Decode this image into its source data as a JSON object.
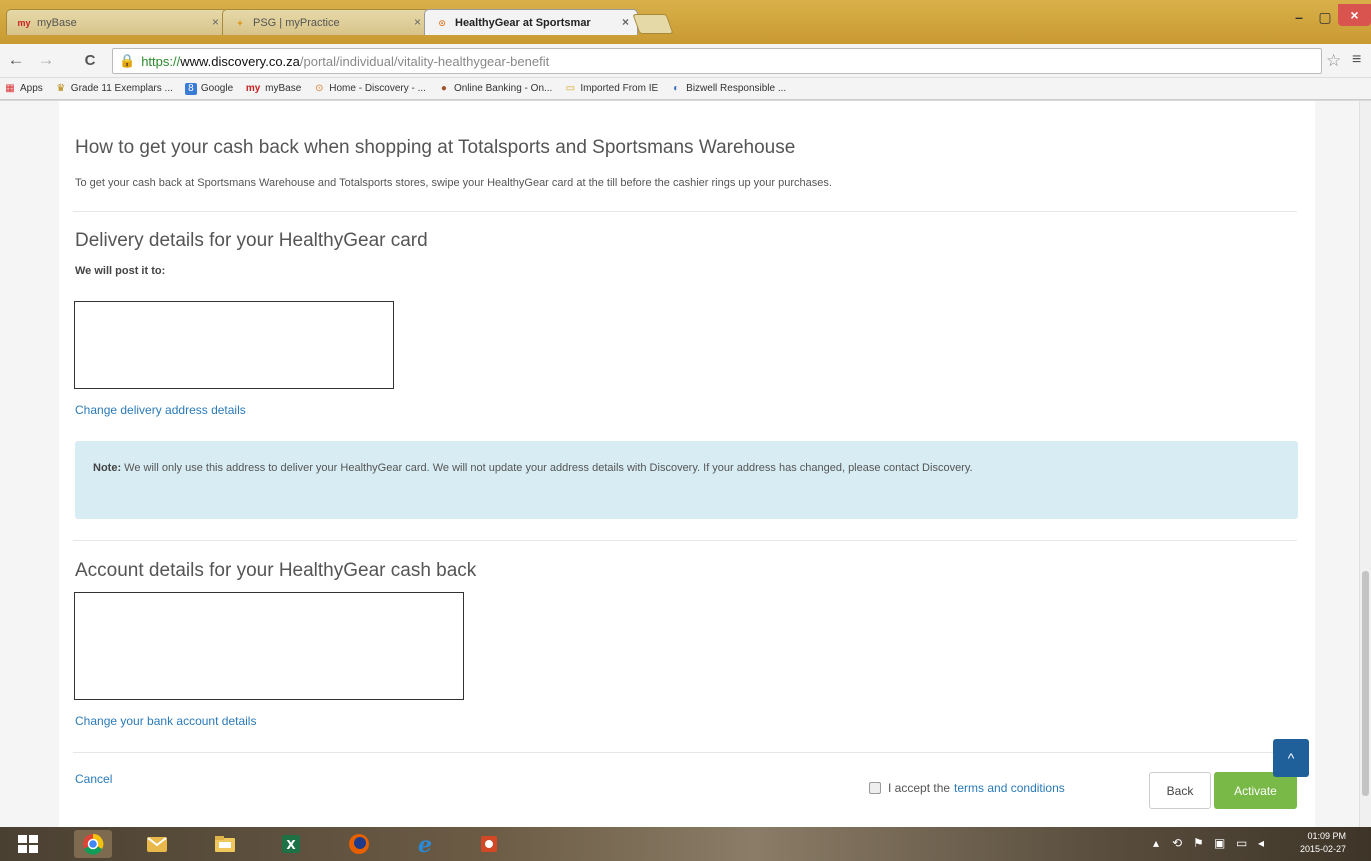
{
  "tabs": [
    {
      "label": "myBase",
      "favicon": "my",
      "close": "×"
    },
    {
      "label": "PSG | myPractice",
      "favicon": "+",
      "close": "×"
    },
    {
      "label": "HealthyGear at Sportsmar",
      "favicon": "⊙",
      "close": "×"
    }
  ],
  "window_controls": {
    "minimize": "–",
    "maximize": "▢",
    "close": "×"
  },
  "nav": {
    "back": "←",
    "forward": "→",
    "reload": "C"
  },
  "address": {
    "scheme": "https://",
    "host": "www.discovery.co.za",
    "path": "/portal/individual/vitality-healthygear-benefit"
  },
  "bookmarks": [
    {
      "label": "Apps",
      "icon": "apps-grid-icon"
    },
    {
      "label": "Grade 11 Exemplars ...",
      "icon": "scroll-icon"
    },
    {
      "label": "Google",
      "icon": "google-icon"
    },
    {
      "label": "myBase",
      "icon": "mybase-icon"
    },
    {
      "label": "Home - Discovery - ...",
      "icon": "discovery-icon"
    },
    {
      "label": "Online Banking - On...",
      "icon": "bank-icon"
    },
    {
      "label": "Imported From IE",
      "icon": "folder-icon"
    },
    {
      "label": "Bizwell Responsible ...",
      "icon": "bizwell-icon"
    }
  ],
  "page": {
    "cashback_title": "How to get your cash back when shopping at Totalsports and Sportsmans Warehouse",
    "cashback_text": "To get your cash back at Sportsmans Warehouse and Totalsports stores, swipe your HealthyGear card at the till before the cashier rings up your purchases.",
    "delivery_title": "Delivery details for your HealthyGear card",
    "delivery_post_label": "We will post it to:",
    "change_delivery": "Change delivery address details",
    "note_label": "Note:",
    "note_text": " We will only use this address to deliver your HealthyGear card. We will not update your address details with Discovery. If your address has changed, please contact Discovery.",
    "account_title": "Account details for your HealthyGear cash back",
    "change_bank": "Change your bank account details",
    "cancel": "Cancel",
    "accept_prefix": "I accept the",
    "terms_link": "terms and conditions",
    "back_button": "Back",
    "activate_button": "Activate",
    "back_to_top": "^"
  },
  "colors": {
    "link": "#2a7ab8",
    "activate": "#78b947",
    "note_bg": "#d8ecf3",
    "to_top": "#1f5f9a"
  },
  "taskbar": {
    "clock_time": "01:09 PM",
    "clock_date": "2015-02-27"
  }
}
